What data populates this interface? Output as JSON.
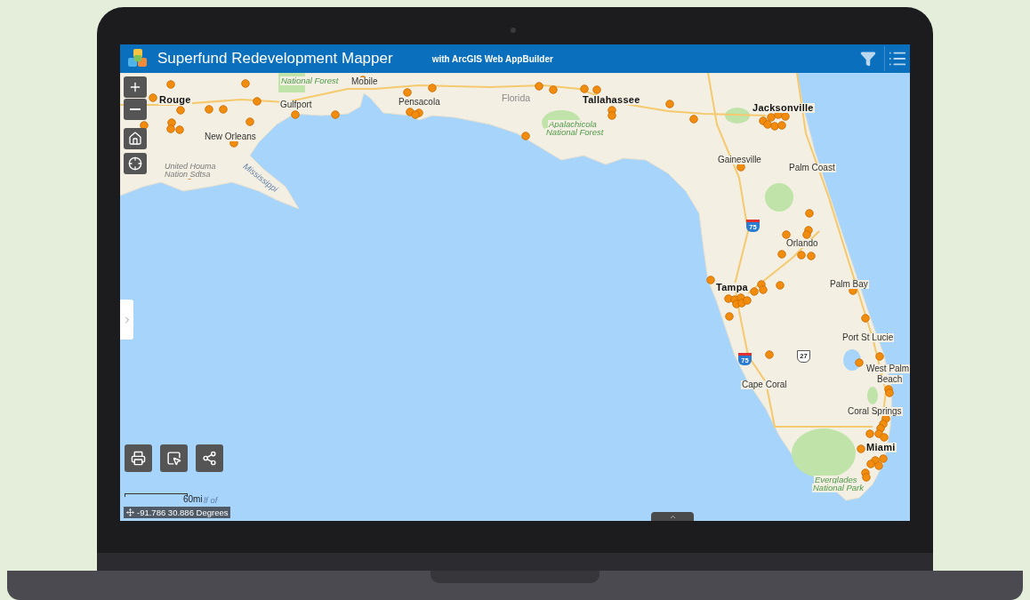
{
  "header": {
    "title": "Superfund Redevelopment Mapper",
    "subtitle": "with ArcGIS Web AppBuilder"
  },
  "map": {
    "labels": [
      {
        "text": "National Forest",
        "kind": "park"
      },
      {
        "text": "Mobile",
        "kind": "city"
      },
      {
        "text": "Rouge",
        "kind": "major"
      },
      {
        "text": "Gulfport",
        "kind": "city"
      },
      {
        "text": "Pensacola",
        "kind": "city"
      },
      {
        "text": "Florida",
        "kind": "region"
      },
      {
        "text": "Tallahassee",
        "kind": "major"
      },
      {
        "text": "Jacksonville",
        "kind": "major"
      },
      {
        "text": "Apalachicola",
        "kind": "park"
      },
      {
        "text": "New Orleans",
        "kind": "city"
      },
      {
        "text": "National Forest",
        "kind": "park"
      },
      {
        "text": "United Houma",
        "kind": "reserve"
      },
      {
        "text": "Gainesville",
        "kind": "city"
      },
      {
        "text": "Nation Sdtsa",
        "kind": "reserve"
      },
      {
        "text": "Palm Coast",
        "kind": "city"
      },
      {
        "text": "Mississippi",
        "kind": "water"
      },
      {
        "text": "Orlando",
        "kind": "city"
      },
      {
        "text": "Tampa",
        "kind": "major"
      },
      {
        "text": "Palm Bay",
        "kind": "city"
      },
      {
        "text": "Port St Lucie",
        "kind": "city"
      },
      {
        "text": "West Palm",
        "kind": "city"
      },
      {
        "text": "Cape Coral",
        "kind": "city"
      },
      {
        "text": "Beach",
        "kind": "city"
      },
      {
        "text": "Coral Springs",
        "kind": "city"
      },
      {
        "text": "Miami",
        "kind": "major"
      },
      {
        "text": "Everglades",
        "kind": "park"
      },
      {
        "text": "National Park",
        "kind": "park"
      },
      {
        "text": "lf of",
        "kind": "water"
      }
    ],
    "route_shields": [
      {
        "text": "75",
        "kind": "interstate"
      },
      {
        "text": "75",
        "kind": "interstate"
      },
      {
        "text": "27",
        "kind": "us"
      }
    ],
    "scale": "60mi",
    "coordinates": "-91.786 30.886 Degrees"
  }
}
